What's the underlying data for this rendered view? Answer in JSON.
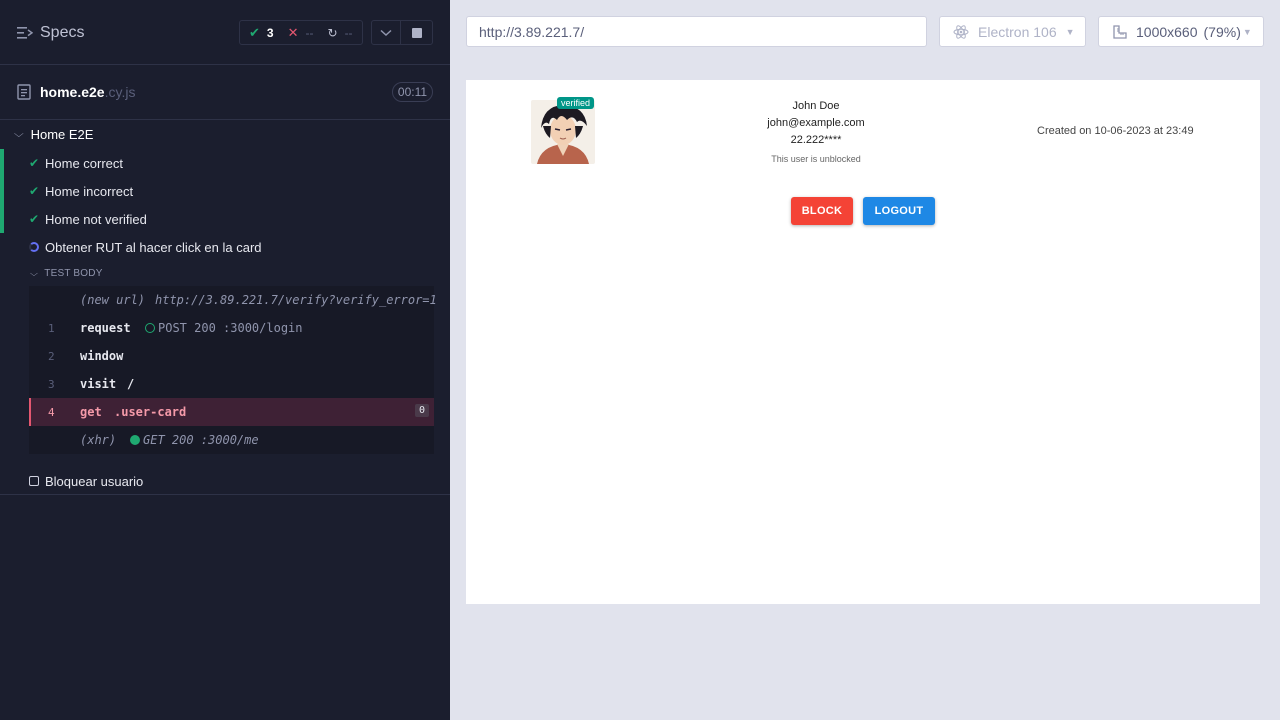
{
  "reporter": {
    "title": "Specs",
    "stats": {
      "passed": "3",
      "failed": "--",
      "pending": "--"
    },
    "spec": {
      "base": "home.e2e",
      "ext": ".cy.js",
      "duration": "00:11"
    },
    "suite": "Home E2E",
    "tests": [
      {
        "label": "Home correct",
        "state": "passed"
      },
      {
        "label": "Home incorrect",
        "state": "passed"
      },
      {
        "label": "Home not verified",
        "state": "passed"
      },
      {
        "label": "Obtener RUT al hacer click en la card",
        "state": "running"
      },
      {
        "label": "Bloquear usuario",
        "state": "pending"
      }
    ],
    "test_body_label": "TEST BODY",
    "commands": [
      {
        "n": "",
        "name": "(new url)",
        "msg": "http://3.89.221.7/verify?verify_error=1"
      },
      {
        "n": "1",
        "name": "request",
        "msg": "POST 200 :3000/login"
      },
      {
        "n": "2",
        "name": "window",
        "msg": ""
      },
      {
        "n": "3",
        "name": "visit",
        "msg": "/"
      },
      {
        "n": "4",
        "name": "get",
        "msg": ".user-card",
        "badge": "0"
      },
      {
        "n": "",
        "name": "(xhr)",
        "msg": "GET 200 :3000/me"
      }
    ]
  },
  "aut_header": {
    "url": "http://3.89.221.7/",
    "browser": "Electron 106",
    "viewport": "1000x660",
    "scale": "(79%)"
  },
  "app": {
    "badge": "verified",
    "name": "John Doe",
    "email": "john@example.com",
    "rut": "22.222****",
    "status": "This user is unblocked",
    "created": "Created on 10-06-2023 at 23:49",
    "block_label": "BLOCK",
    "logout_label": "LOGOUT"
  },
  "colors": {
    "panel_bg": "#1b1e2e",
    "pass": "#1fa971",
    "fail": "#e45770",
    "block": "#f44336",
    "logout": "#1e88e5",
    "verified": "#009688"
  }
}
